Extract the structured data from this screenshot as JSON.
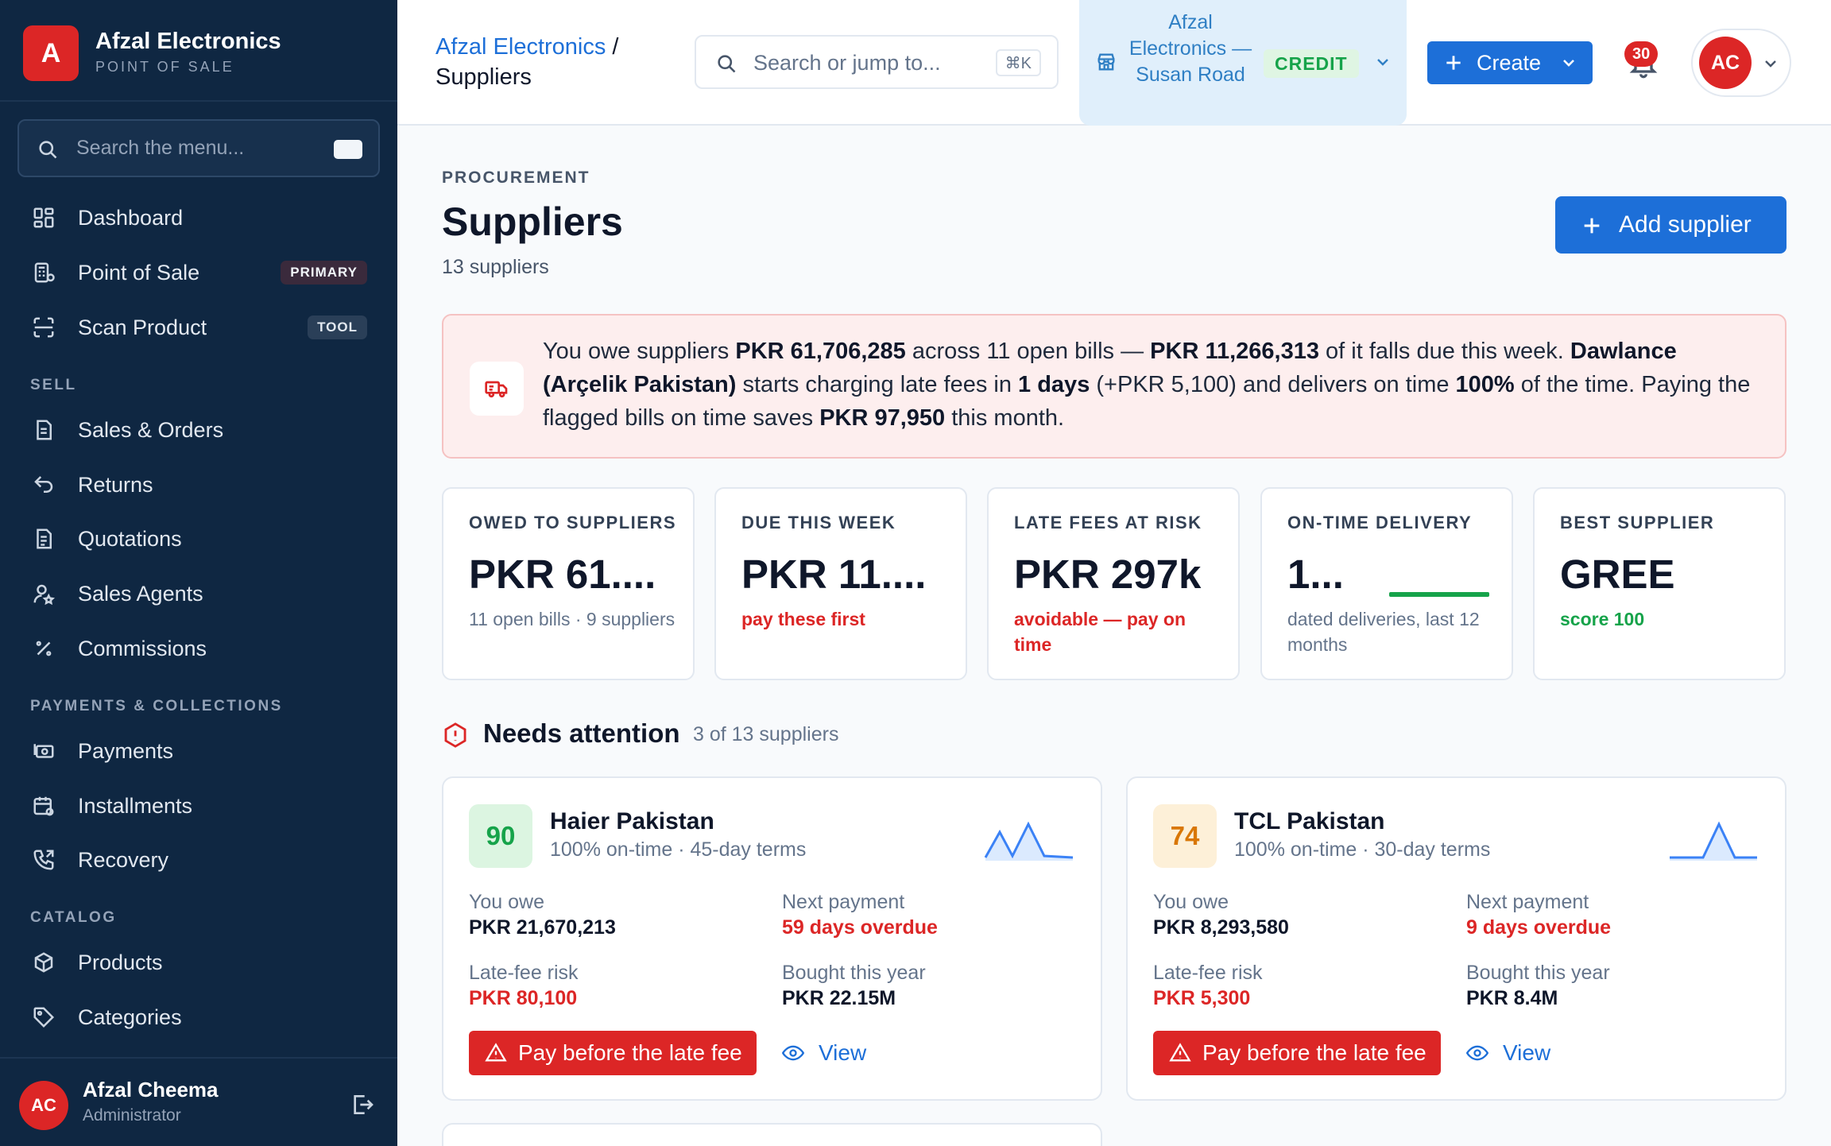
{
  "brand": {
    "logo_letter": "A",
    "name": "Afzal Electronics",
    "subtitle": "POINT OF SALE"
  },
  "sidebar": {
    "search_placeholder": "Search the menu...",
    "items": [
      {
        "label": "Dashboard",
        "icon": "dashboard-icon"
      },
      {
        "label": "Point of Sale",
        "icon": "pos-icon",
        "tag": "PRIMARY"
      },
      {
        "label": "Scan Product",
        "icon": "scan-icon",
        "tag": "TOOL"
      },
      {
        "label": "Sales & Orders",
        "icon": "receipt-icon"
      },
      {
        "label": "Returns",
        "icon": "undo-icon"
      },
      {
        "label": "Quotations",
        "icon": "document-icon"
      },
      {
        "label": "Sales Agents",
        "icon": "user-star-icon"
      },
      {
        "label": "Commissions",
        "icon": "percent-icon"
      },
      {
        "label": "Payments",
        "icon": "cash-icon"
      },
      {
        "label": "Installments",
        "icon": "calendar-icon"
      },
      {
        "label": "Recovery",
        "icon": "phone-icon"
      },
      {
        "label": "Products",
        "icon": "box-icon"
      },
      {
        "label": "Categories",
        "icon": "tag-icon"
      }
    ],
    "sections": [
      "SELL",
      "PAYMENTS & COLLECTIONS",
      "CATALOG"
    ],
    "user": {
      "initials": "AC",
      "name": "Afzal Cheema",
      "role": "Administrator"
    }
  },
  "topbar": {
    "breadcrumb_link": "Afzal Electronics",
    "breadcrumb_sep": "/",
    "breadcrumb_current": "Suppliers",
    "search_placeholder": "Search or jump to...",
    "search_shortcut": "⌘K",
    "store_name": "Afzal Electronics — Susan Road",
    "store_mode": "CREDIT",
    "create_label": "Create",
    "notifications": "30",
    "user_initials": "AC"
  },
  "page": {
    "eyebrow": "PROCUREMENT",
    "title": "Suppliers",
    "subtitle": "13 suppliers",
    "add_label": "Add supplier"
  },
  "alert": {
    "t1": "You owe suppliers ",
    "b1": "PKR 61,706,285",
    "t2": " across 11 open bills — ",
    "b2": "PKR 11,266,313",
    "t3": " of it falls due this week. ",
    "b3": "Dawlance (Arçelik Pakistan)",
    "t4": " starts charging late fees in ",
    "b4": "1 days",
    "t5": " (+PKR 5,100) and delivers on time ",
    "b5": "100%",
    "t6": " of the time. Paying the flagged bills on time saves ",
    "b6": "PKR 97,950",
    "t7": " this month."
  },
  "kpis": [
    {
      "label": "OWED TO SUPPLIERS",
      "value": "PKR 61....",
      "sub": "11 open bills · 9 suppliers"
    },
    {
      "label": "DUE THIS WEEK",
      "value": "PKR 11....",
      "sub": "pay these first"
    },
    {
      "label": "LATE FEES AT RISK",
      "value": "PKR 297k",
      "sub": "avoidable — pay on time"
    },
    {
      "label": "ON-TIME DELIVERY",
      "value": "1...",
      "sub": "dated deliveries, last 12 months"
    },
    {
      "label": "BEST SUPPLIER",
      "value": "GREE",
      "sub": "score 100"
    }
  ],
  "attention": {
    "title": "Needs attention",
    "count": "3 of 13 suppliers"
  },
  "field_labels": {
    "owe": "You owe",
    "next": "Next payment",
    "risk": "Late-fee risk",
    "bought": "Bought this year"
  },
  "actions": {
    "pay": "Pay before the late fee",
    "view": "View"
  },
  "suppliers": [
    {
      "score": "90",
      "name": "Haier Pakistan",
      "meta": "100% on-time · 45-day terms",
      "owe": "PKR 21,670,213",
      "next": "59 days overdue",
      "risk": "PKR 80,100",
      "bought": "PKR 22.15M"
    },
    {
      "score": "74",
      "name": "TCL Pakistan",
      "meta": "100% on-time · 30-day terms",
      "owe": "PKR 8,293,580",
      "next": "9 days overdue",
      "risk": "PKR 5,300",
      "bought": "PKR 8.4M"
    }
  ],
  "colors": {
    "sidebar": "#0f2742",
    "accent": "#1d6fd8",
    "danger": "#dc2626",
    "success": "#16a34a",
    "warning": "#d97706"
  }
}
